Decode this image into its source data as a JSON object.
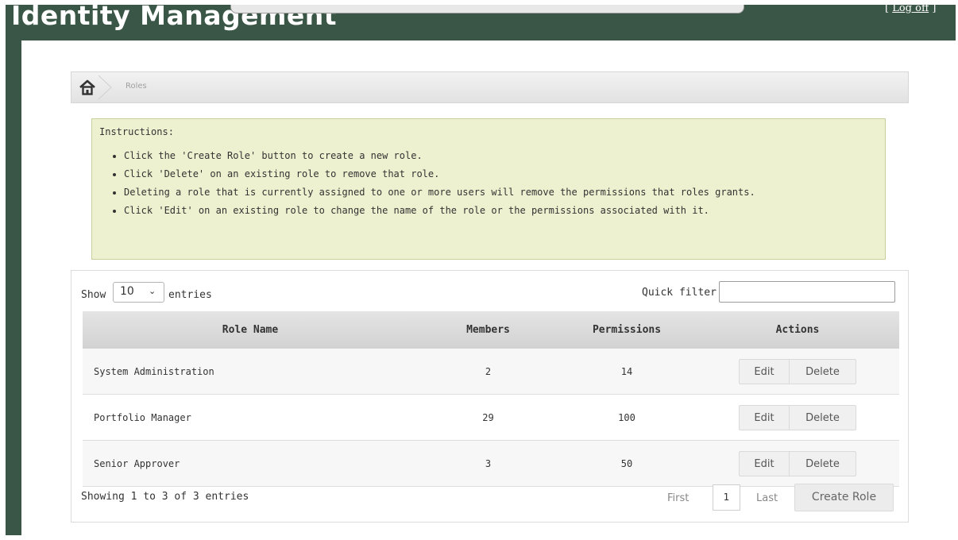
{
  "header": {
    "app_title": "Identity Management",
    "logoff_left": "[ ",
    "logoff_label": "Log off",
    "logoff_right": " ]"
  },
  "breadcrumb": {
    "home_icon": "home-icon",
    "current": "Roles"
  },
  "instructions": {
    "heading": "Instructions:",
    "items": [
      "Click the 'Create Role' button to create a new role.",
      "Click 'Delete' on an existing role to remove that role.",
      "Deleting a role that is currently assigned to one or more users will remove the permissions that roles grants.",
      "Click 'Edit' on an existing role to change the name of the role or the permissions associated with it."
    ]
  },
  "table_controls": {
    "show_label": "Show",
    "page_size": "10",
    "entries_label": "entries",
    "filter_label": "Quick filter:",
    "filter_value": ""
  },
  "table": {
    "columns": [
      "Role Name",
      "Members",
      "Permissions",
      "Actions"
    ],
    "rows": [
      {
        "name": "System Administration",
        "members": "2",
        "permissions": "14",
        "edit": "Edit",
        "delete": "Delete"
      },
      {
        "name": "Portfolio Manager",
        "members": "29",
        "permissions": "100",
        "edit": "Edit",
        "delete": "Delete"
      },
      {
        "name": "Senior Approver",
        "members": "3",
        "permissions": "50",
        "edit": "Edit",
        "delete": "Delete"
      }
    ]
  },
  "footer": {
    "info": "Showing 1 to 3 of 3 entries",
    "first": "First",
    "page": "1",
    "last": "Last",
    "create_label": "Create Role"
  },
  "colors": {
    "header_bg": "#3a5646",
    "instructions_bg": "#edf1cf",
    "table_header_bg": "#d8d8d8"
  }
}
